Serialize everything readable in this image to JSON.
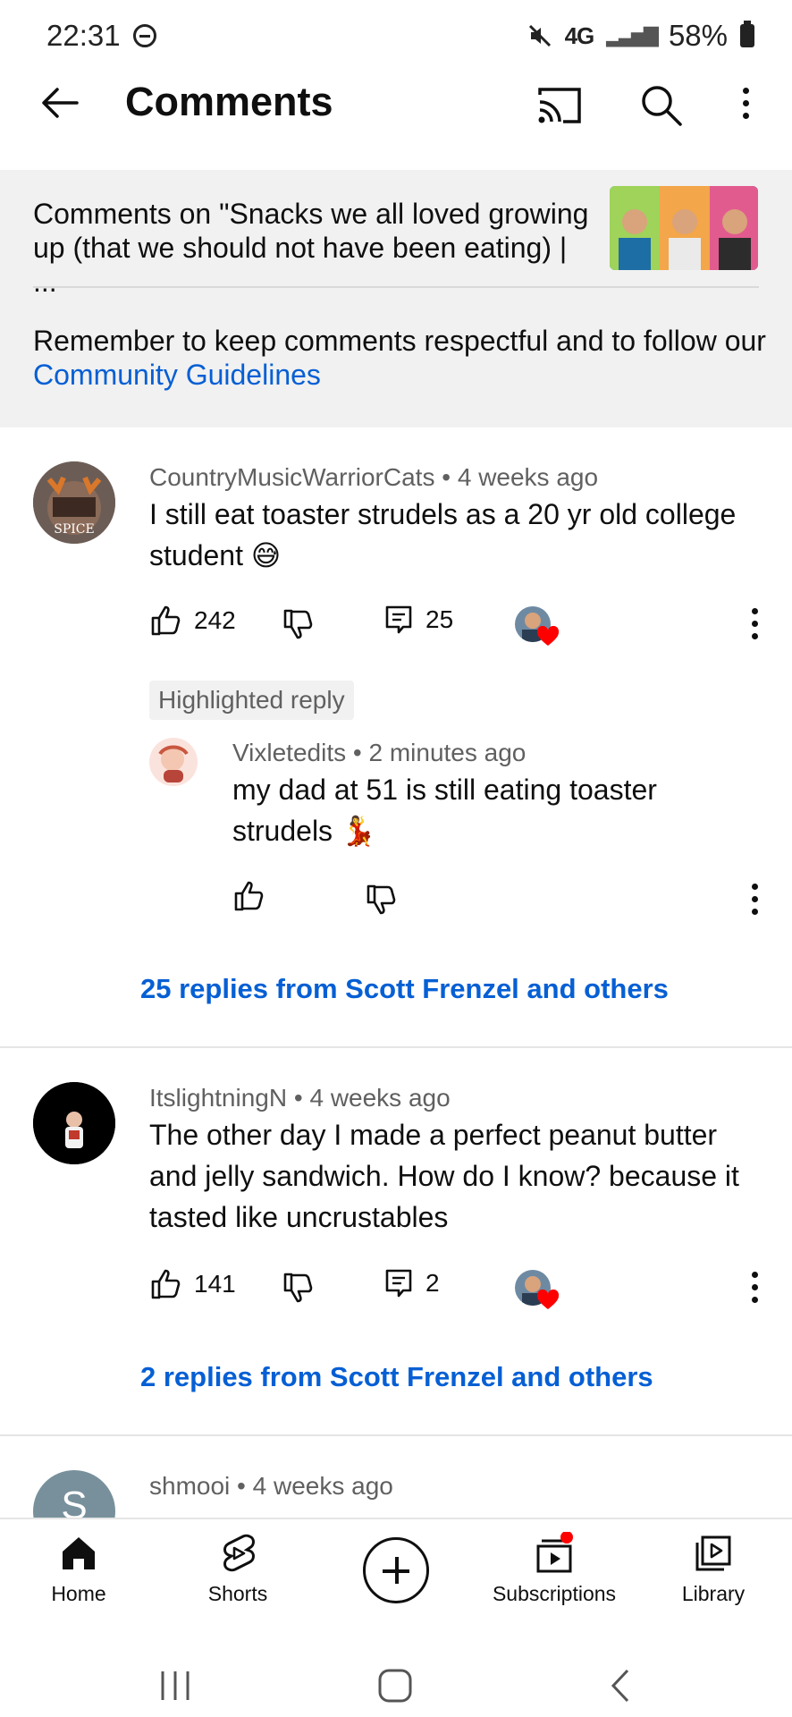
{
  "status_bar": {
    "time": "22:31",
    "network": "4G",
    "battery": "58%"
  },
  "header": {
    "title": "Comments"
  },
  "panel": {
    "video_title": "Comments on \"Snacks we all loved growing up (that we should not have been eating) | ...",
    "rules_text": "Remember to keep comments respectful and to follow our ",
    "rules_link": "Community Guidelines"
  },
  "comments": [
    {
      "author": "CountryMusicWarriorCats",
      "age": "4 weeks ago",
      "text": "I still eat toaster strudels as a 20 yr old college student 😅",
      "likes": "242",
      "replies": "25",
      "highlight_label": "Highlighted reply",
      "reply": {
        "author": "Vixletedits",
        "age": "2 minutes ago",
        "text": "my dad at 51 is still eating toaster strudels 💃"
      },
      "replies_link": "25 replies from Scott Frenzel and others"
    },
    {
      "author": "ItslightningN",
      "age": "4 weeks ago",
      "text": "The other day I made a perfect peanut butter and jelly sandwich. How do I know? because it tasted like uncrustables",
      "likes": "141",
      "replies": "2",
      "replies_link": "2 replies from Scott Frenzel and others"
    },
    {
      "author": "shmooi",
      "age": "4 weeks ago",
      "avatar_letter": "S"
    }
  ],
  "bottom_nav": {
    "home": "Home",
    "shorts": "Shorts",
    "subscriptions": "Subscriptions",
    "library": "Library"
  },
  "colors": {
    "link": "#065fd4",
    "panel_bg": "#f1f1f1",
    "heart": "#ff0000"
  }
}
